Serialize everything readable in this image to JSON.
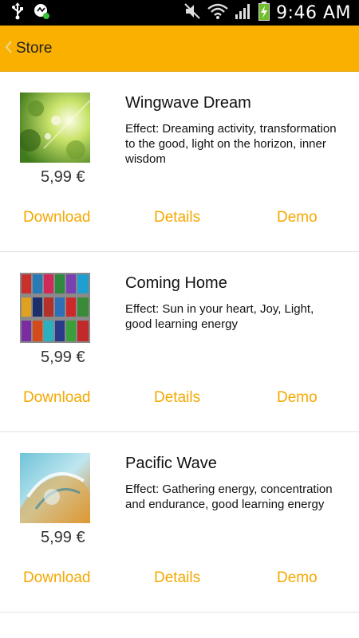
{
  "status_bar": {
    "time": "9:46 AM",
    "icons": [
      "usb-icon",
      "notification-app-icon",
      "mute-icon",
      "wifi-icon",
      "signal-icon",
      "battery-charging-icon"
    ]
  },
  "action_bar": {
    "back_label": "Store",
    "color": "#f9b000"
  },
  "items": [
    {
      "title": "Wingwave Dream",
      "description": "Effect: Dreaming activity, transformation to the good, light on the horizon, inner wisdom",
      "price": "5,99 €",
      "download_label": "Download",
      "details_label": "Details",
      "demo_label": "Demo"
    },
    {
      "title": "Coming Home",
      "description": "Effect: Sun in your heart, Joy, Light, good learning energy",
      "price": "5,99 €",
      "download_label": "Download",
      "details_label": "Details",
      "demo_label": "Demo"
    },
    {
      "title": "Pacific Wave",
      "description": "Effect: Gathering energy, concentration and endurance, good learning energy",
      "price": "5,99 €",
      "download_label": "Download",
      "details_label": "Details",
      "demo_label": "Demo"
    }
  ]
}
